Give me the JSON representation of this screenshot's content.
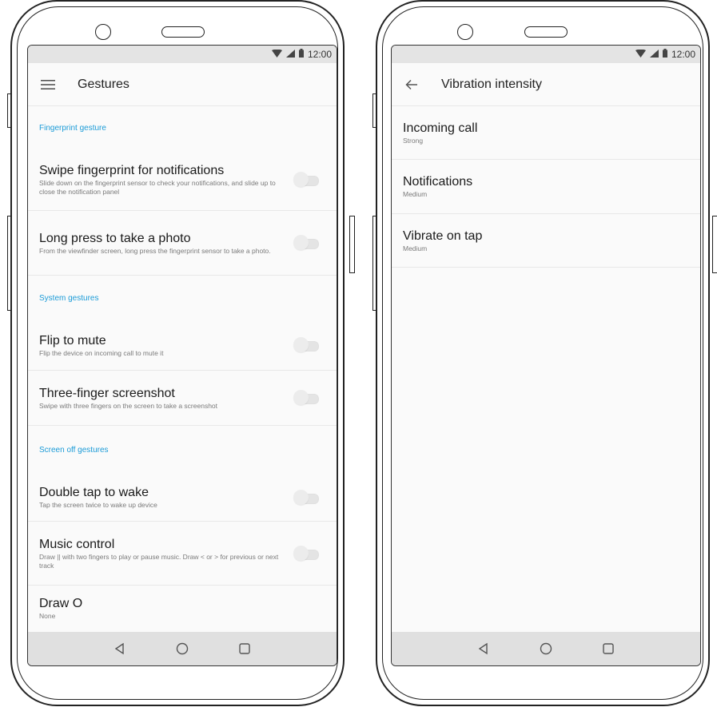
{
  "left_screen": {
    "status_time": "12:00",
    "title": "Gestures",
    "sections": [
      {
        "header": "Fingerprint gesture",
        "items": [
          {
            "title": "Swipe fingerprint for notifications",
            "summary": "Slide down on the fingerprint sensor to check your notifications, and slide up to close the notification panel",
            "toggle": false
          },
          {
            "title": "Long press to take a photo",
            "summary": "From the viewfinder screen, long press the fingerprint sensor to take a photo.",
            "toggle": false
          }
        ]
      },
      {
        "header": "System gestures",
        "items": [
          {
            "title": "Flip to mute",
            "summary": "Flip the device on incoming call to mute it",
            "toggle": false
          },
          {
            "title": "Three-finger screenshot",
            "summary": "Swipe with three fingers on the screen to take a screenshot",
            "toggle": false
          }
        ]
      },
      {
        "header": "Screen off gestures",
        "items": [
          {
            "title": "Double tap to wake",
            "summary": "Tap the screen twice to wake up device",
            "toggle": false
          },
          {
            "title": "Music control",
            "summary": "Draw || with two fingers to play or pause music. Draw < or > for previous or next track",
            "toggle": false
          },
          {
            "title": "Draw O",
            "summary": "None"
          }
        ]
      }
    ]
  },
  "right_screen": {
    "status_time": "12:00",
    "title": "Vibration intensity",
    "items": [
      {
        "title": "Incoming call",
        "summary": "Strong"
      },
      {
        "title": "Notifications",
        "summary": "Medium"
      },
      {
        "title": "Vibrate on tap",
        "summary": "Medium"
      }
    ]
  },
  "colors": {
    "accent": "#1b9bd7",
    "background": "#fafafa",
    "statusbar": "#e4e4e4",
    "navbar": "#e0e0e0"
  },
  "icons": {
    "menu": "hamburger-menu-icon",
    "back": "back-arrow-icon",
    "wifi": "wifi-icon",
    "signal": "signal-icon",
    "battery": "battery-icon",
    "nav_back": "triangle-back-icon",
    "nav_home": "circle-home-icon",
    "nav_recents": "square-recents-icon"
  }
}
